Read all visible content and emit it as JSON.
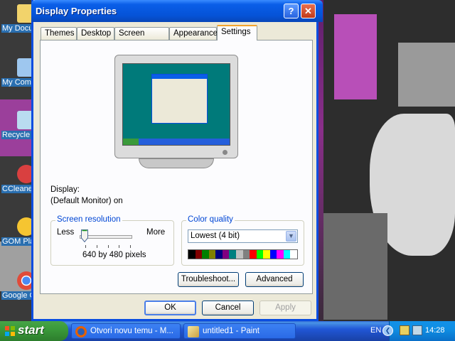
{
  "window": {
    "title": "Display Properties",
    "help_btn": "?",
    "close_btn": "✕"
  },
  "tabs": [
    {
      "label": "Themes"
    },
    {
      "label": "Desktop"
    },
    {
      "label": "Screen Saver"
    },
    {
      "label": "Appearance"
    },
    {
      "label": "Settings",
      "active": true
    }
  ],
  "display": {
    "label": "Display:",
    "value": "(Default Monitor) on"
  },
  "resolution": {
    "group_title": "Screen resolution",
    "less": "Less",
    "more": "More",
    "value_text": "640 by 480 pixels",
    "slider_position": 0
  },
  "color_quality": {
    "group_title": "Color quality",
    "selected": "Lowest (4 bit)",
    "swatches": [
      "#000000",
      "#800000",
      "#008000",
      "#808000",
      "#000080",
      "#800080",
      "#008080",
      "#c0c0c0",
      "#808080",
      "#ff0000",
      "#00ff00",
      "#ffff00",
      "#0000ff",
      "#ff00ff",
      "#00ffff",
      "#ffffff"
    ]
  },
  "buttons": {
    "troubleshoot": "Troubleshoot...",
    "advanced": "Advanced",
    "ok": "OK",
    "cancel": "Cancel",
    "apply": "Apply"
  },
  "desktop_icons": [
    {
      "label": "My Documents",
      "color": "#f2d36b"
    },
    {
      "label": "My Computer",
      "color": "#9ec7ef"
    },
    {
      "label": "Recycle Bin",
      "color": "#b9dcf0"
    },
    {
      "label": "CCleaner",
      "color": "#d94040"
    },
    {
      "label": "GOM Player",
      "color": "#f5c531"
    },
    {
      "label": "Google Chrome",
      "color": "#e04b3a"
    }
  ],
  "taskbar": {
    "start_label": "start",
    "tasks": [
      {
        "label": "Otvori novu temu - M...",
        "icon": "firefox-icon"
      },
      {
        "label": "untitled1 - Paint",
        "icon": "paint-icon"
      }
    ],
    "language": "EN",
    "clock": "14:28"
  }
}
